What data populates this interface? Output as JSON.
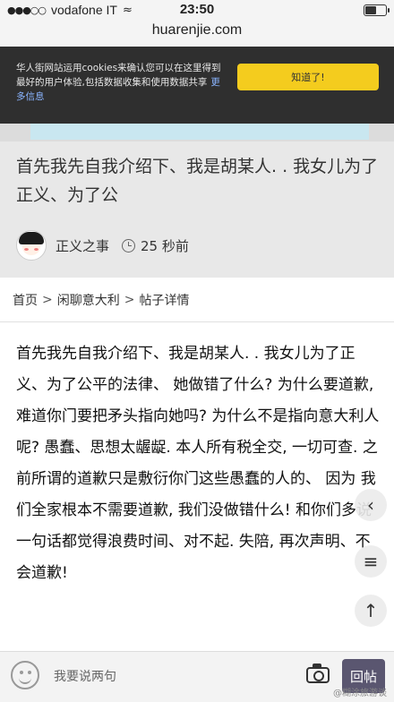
{
  "status_bar": {
    "signal_dots": "●●●○○",
    "carrier": "vodafone IT",
    "time": "23:50"
  },
  "browser": {
    "url": "huarenjie.com"
  },
  "cookie_banner": {
    "text": "华人街网站运用cookies来确认您可以在这里得到最好的用户体验,包括数据收集和使用数据共享",
    "more_link": "更多信息",
    "accept_label": "知道了!"
  },
  "post_header": {
    "title": "首先我先自我介绍下、我是胡某人. . 我女儿为了正义、为了公",
    "author": "正义之事",
    "time": "25 秒前"
  },
  "breadcrumb": {
    "items": [
      "首页",
      "闲聊意大利",
      "帖子详情"
    ],
    "separator": ">"
  },
  "post_body": "首先我先自我介绍下、我是胡某人. . 我女儿为了正义、为了公平的法律、 她做错了什么? 为什么要道歉, 难道你门要把矛头指向她吗? 为什么不是指向意大利人呢? 愚蠢、思想太龌龊. 本人所有税全交, 一切可查. 之前所谓的道歉只是敷衍你门这些愚蠢的人的、 因为 我们全家根本不需要道歉, 我们没做错什么! 和你们多说一句话都觉得浪费时间、对不起. 失陪, 再次声明、不会道歉!",
  "floating": {
    "back": "‹",
    "menu": "≡",
    "top": "↑"
  },
  "reply_bar": {
    "placeholder": "我要说两句",
    "submit_label": "回帖"
  },
  "watermark": "@糊涂旅游谈"
}
